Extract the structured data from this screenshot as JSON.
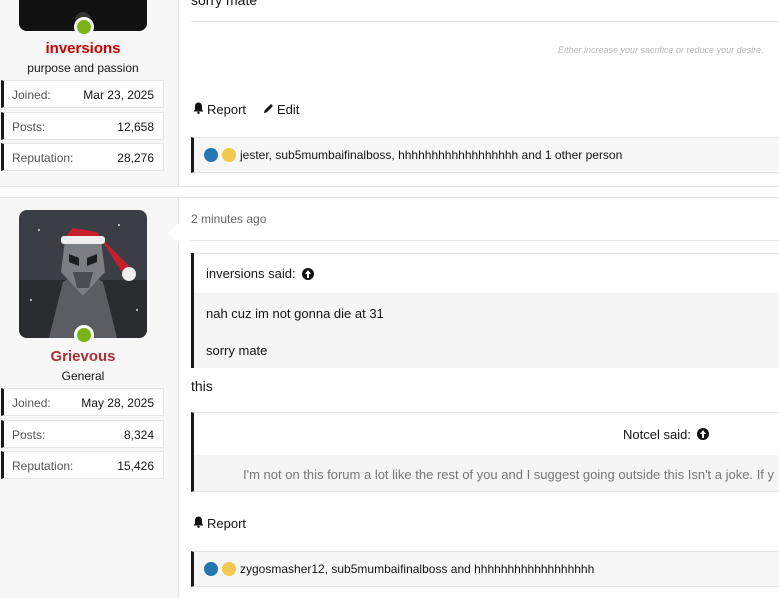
{
  "post1": {
    "body_tail": "sorry mate",
    "signature": "Either increase your sacrifice or reduce your desire.",
    "user": {
      "name": "inversions",
      "name_color": "#cc0000",
      "title": "purpose and passion",
      "stats": [
        {
          "label": "Joined:",
          "value": "Mar 23, 2025"
        },
        {
          "label": "Posts:",
          "value": "12,658"
        },
        {
          "label": "Reputation:",
          "value": "28,276"
        }
      ]
    },
    "actions": {
      "report": "Report",
      "edit": "Edit"
    },
    "reactions": "jester, sub5mumbaifinalboss, hhhhhhhhhhhhhhhhhh and 1 other person"
  },
  "post2": {
    "timestamp": "2 minutes ago",
    "user": {
      "name": "Grievous",
      "name_color": "#a8323a",
      "title": "General",
      "stats": [
        {
          "label": "Joined:",
          "value": "May 28, 2025"
        },
        {
          "label": "Posts:",
          "value": "8,324"
        },
        {
          "label": "Reputation:",
          "value": "15,426"
        }
      ]
    },
    "quote1": {
      "author": "inversions said:",
      "lines": [
        "nah cuz im not gonna die at 31",
        "sorry mate"
      ]
    },
    "body": "this",
    "quote2": {
      "author": "Notcel said:",
      "line": "I'm not on this forum a lot like the rest of you and I suggest going outside this Isn't a joke. If y"
    },
    "actions": {
      "report": "Report"
    },
    "reactions": "zygosmasher12, sub5mumbaifinalboss and hhhhhhhhhhhhhhhhhh"
  },
  "icons": {
    "online": "online-status-dot",
    "bell": "bell-icon",
    "pencil": "pencil-icon",
    "like": "like-icon",
    "haha": "haha-icon",
    "quote_arrow": "arrow-up-circle-icon"
  },
  "colors": {
    "online": "#7ab317",
    "like": "#2577b1",
    "haha": "#f2c94c"
  }
}
